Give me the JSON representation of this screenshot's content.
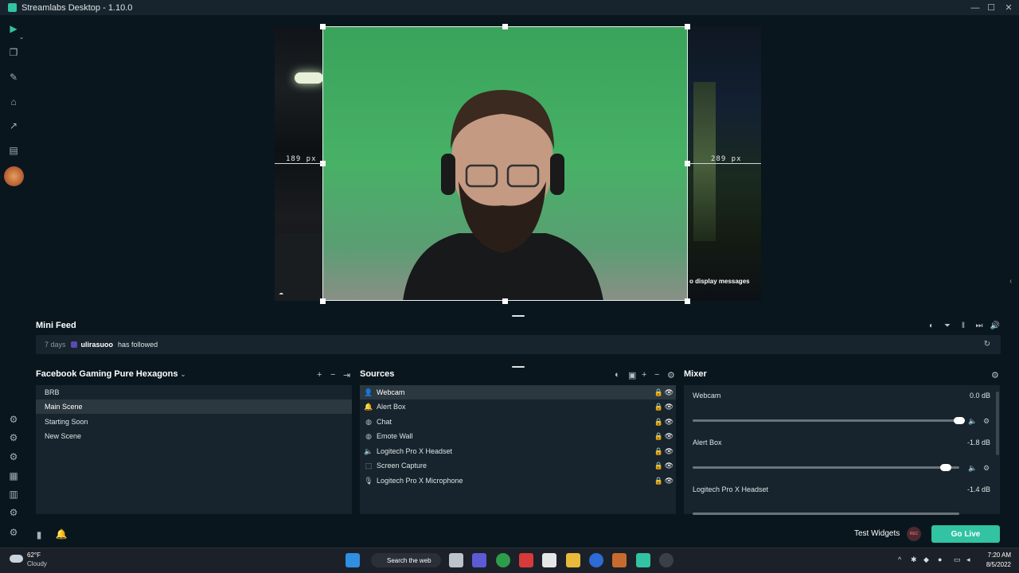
{
  "window": {
    "title": "Streamlabs Desktop - 1.10.0",
    "controls": [
      "—",
      "☐",
      "✕"
    ]
  },
  "leftnav": {
    "icons": [
      "editor-icon",
      "themes-icon",
      "tools-icon",
      "store-icon",
      "stats-icon",
      "studio-icon",
      "avatar"
    ],
    "bottom_icons": [
      "overlay-icon",
      "integrations-icon",
      "alerts-icon",
      "apps-icon",
      "layout-icon",
      "studio-mode-icon",
      "settings-icon"
    ]
  },
  "editor": {
    "guide_left": "189 px",
    "guide_right": "289 px",
    "overlay_text": "o display messages"
  },
  "minifeed": {
    "title": "Mini Feed",
    "event": {
      "days": "7 days",
      "user": "ulirasuoo",
      "action": "has followed"
    },
    "controls": [
      "◐",
      "⏷",
      "‖",
      "⏭",
      "🔊"
    ]
  },
  "scenes": {
    "title": "Facebook Gaming Pure Hexagons",
    "items": [
      {
        "label": "BRB",
        "active": false
      },
      {
        "label": "Main Scene",
        "active": true
      },
      {
        "label": "Starting Soon",
        "active": false
      },
      {
        "label": "New Scene",
        "active": false
      }
    ]
  },
  "sources": {
    "title": "Sources",
    "items": [
      {
        "label": "Webcam",
        "icon": "👤",
        "active": true
      },
      {
        "label": "Alert Box",
        "icon": "🔔",
        "active": false
      },
      {
        "label": "Chat",
        "icon": "◍",
        "active": false
      },
      {
        "label": "Emote Wall",
        "icon": "◍",
        "active": false
      },
      {
        "label": "Logitech Pro X Headset",
        "icon": "🔈",
        "active": false
      },
      {
        "label": "Screen Capture",
        "icon": "⬚",
        "active": false
      },
      {
        "label": "Logitech Pro X Microphone",
        "icon": "🎙",
        "active": false
      }
    ]
  },
  "mixer": {
    "title": "Mixer",
    "items": [
      {
        "label": "Webcam",
        "db": "0.0 dB",
        "level": 1.0
      },
      {
        "label": "Alert Box",
        "db": "-1.8 dB",
        "level": 0.95
      },
      {
        "label": "Logitech Pro X Headset",
        "db": "-1.4 dB",
        "level": 0.96
      }
    ]
  },
  "footer": {
    "test_widgets": "Test Widgets",
    "rec": "REC",
    "go_live": "Go Live"
  },
  "taskbar": {
    "temp": "62°F",
    "condition": "Cloudy",
    "search": "Search the web",
    "time": "7:20 AM",
    "date": "8/5/2022"
  },
  "colors": {
    "accent": "#31c3a2",
    "panel": "#17242d",
    "bg": "#09161d",
    "active_row": "#2b383f"
  }
}
